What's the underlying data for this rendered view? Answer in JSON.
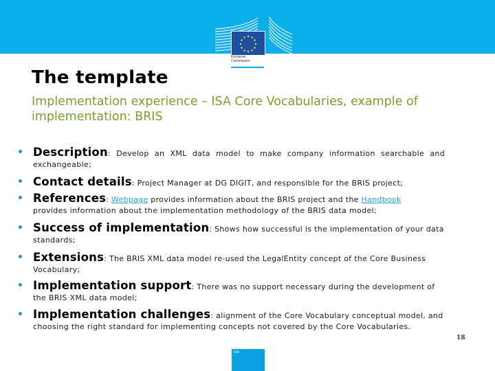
{
  "header": {
    "logo": {
      "name": "european-commission-logo",
      "line1": "European",
      "line2": "Commission"
    },
    "colors": {
      "banner": "#0aaee8",
      "flag": "#1e4f9f"
    }
  },
  "slide": {
    "title": "The template",
    "subtitle": "Implementation experience – ISA Core Vocabularies, example of implementation: BRIS",
    "colors": {
      "subtitle": "#7a9f2a",
      "bullet": "#2a8fd1",
      "link": "#2a9fd8",
      "page_number": "#1f3b66"
    },
    "items": [
      {
        "label": "Description",
        "sep": ": ",
        "text1": "Develop an XML data model to make company information searchable and",
        "text2": "exchangeable;"
      },
      {
        "label": "Contact details",
        "sep": ": ",
        "text1": "Project Manager at DG DIGIT, and responsible for the BRIS project;"
      },
      {
        "label": "References",
        "sep": ": ",
        "link1": "Webpage",
        "mid1": " provides information about the BRIS project and the ",
        "link2": "Handbook",
        "text2": "provides information about the implementation methodology of the BRIS data model;"
      },
      {
        "label": "Success of implementation",
        "sep": ": ",
        "text1": "Shows how successful is the implementation of your data",
        "text2": "standards;"
      },
      {
        "label": "Extensions",
        "sep": ": ",
        "text1": "The BRIS XML data model re-used the LegalEntity concept of the Core Business",
        "text2": "Vocabulary;"
      },
      {
        "label": "Implementation support",
        "sep": ": ",
        "text1": "There was no support necessary during the development of",
        "text2": "the BRIS XML data model;"
      },
      {
        "label": "Implementation challenges",
        "sep": ": ",
        "text1": "alignment of the Core Vocabulary conceptual model, and",
        "text2": "choosing the right standard for implementing concepts not covered by the Core Vocabularies."
      }
    ],
    "page_number": "18"
  },
  "footer": {
    "logo_text": "ISA"
  }
}
